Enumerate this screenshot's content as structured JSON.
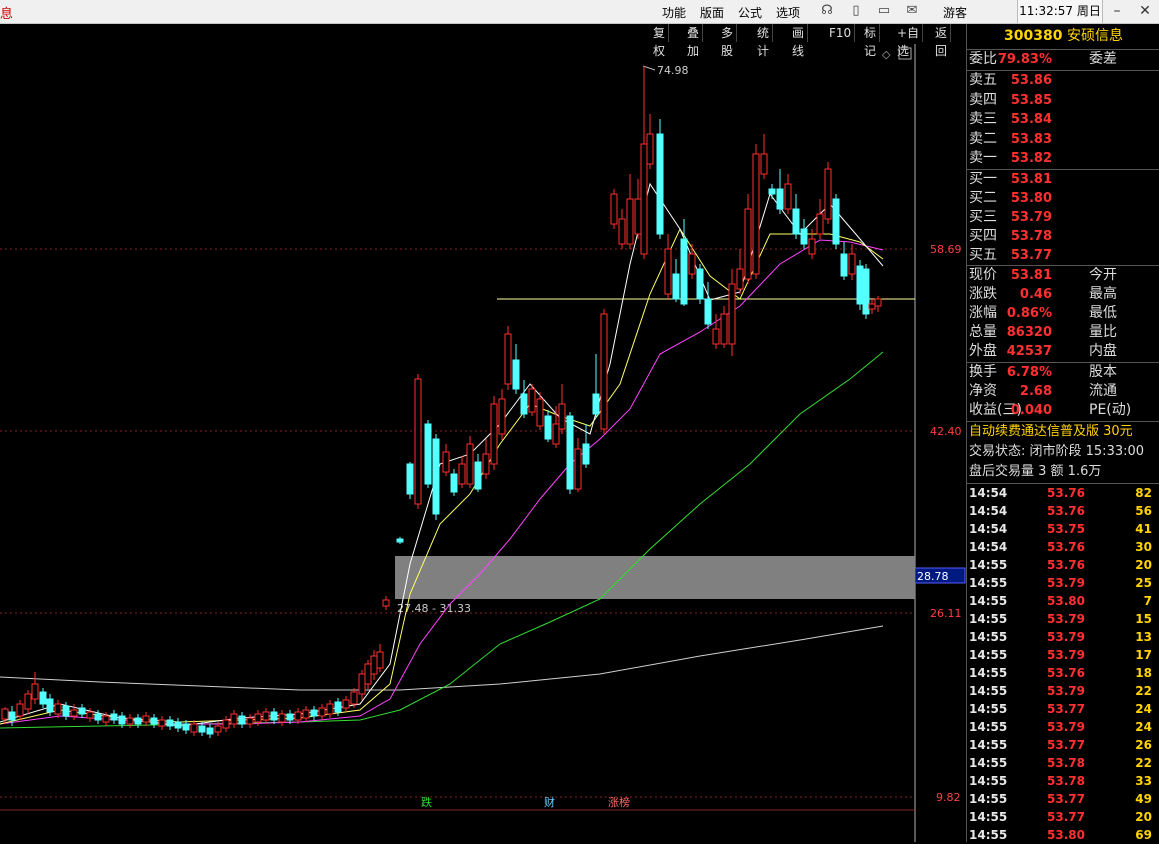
{
  "menubar": {
    "left_title": "息",
    "items": [
      "功能",
      "版面",
      "公式",
      "选项"
    ],
    "user": "游客",
    "clock": "11:32:57 周日"
  },
  "toolbar": [
    "复权",
    "叠加",
    "多股",
    "统计",
    "画线",
    "F10",
    "标记",
    "+自选",
    "返回"
  ],
  "chart": {
    "price_labels": [
      "58.69",
      "42.40",
      "26.11",
      "9.82"
    ],
    "current_box": "28.78",
    "high_label": "74.98",
    "zone_label": "27.48 - 31.33",
    "markers": [
      "跌",
      "财",
      "涨榜"
    ]
  },
  "chart_data": {
    "type": "candlestick",
    "y_axis_labels": [
      58.69,
      42.4,
      26.11,
      9.82
    ],
    "high": 74.98,
    "last": 53.81,
    "zone": [
      27.48,
      31.33
    ]
  },
  "panel": {
    "code": "300380",
    "name": "安硕信息",
    "weibi": {
      "label": "委比",
      "value": "79.83%",
      "label2": "委差"
    },
    "sell": [
      {
        "label": "卖五",
        "price": "53.86"
      },
      {
        "label": "卖四",
        "price": "53.85"
      },
      {
        "label": "卖三",
        "price": "53.84"
      },
      {
        "label": "卖二",
        "price": "53.83"
      },
      {
        "label": "卖一",
        "price": "53.82"
      }
    ],
    "buy": [
      {
        "label": "买一",
        "price": "53.81"
      },
      {
        "label": "买二",
        "price": "53.80"
      },
      {
        "label": "买三",
        "price": "53.79"
      },
      {
        "label": "买四",
        "price": "53.78"
      },
      {
        "label": "买五",
        "price": "53.77"
      }
    ],
    "quote": [
      {
        "label": "现价",
        "value": "53.81",
        "label2": "今开"
      },
      {
        "label": "涨跌",
        "value": "0.46",
        "label2": "最高"
      },
      {
        "label": "涨幅",
        "value": "0.86%",
        "label2": "最低"
      },
      {
        "label": "总量",
        "value": "86320",
        "label2": "量比"
      },
      {
        "label": "外盘",
        "value": "42537",
        "label2": "内盘"
      }
    ],
    "finance": [
      {
        "label": "换手",
        "value": "6.78%",
        "label2": "股本"
      },
      {
        "label": "净资",
        "value": "2.68",
        "label2": "流通"
      },
      {
        "label": "收益(三)",
        "value": "0.040",
        "label2": "PE(动)"
      }
    ],
    "ad_text": "自动续费通达信普及版 30元",
    "trade_status": "交易状态: 闭市阶段 15:33:00",
    "after_hours": "盘后交易量 3 额 1.6万",
    "ticks": [
      {
        "t": "14:54",
        "p": "53.76",
        "v": "82"
      },
      {
        "t": "14:54",
        "p": "53.76",
        "v": "56"
      },
      {
        "t": "14:54",
        "p": "53.75",
        "v": "41"
      },
      {
        "t": "14:54",
        "p": "53.76",
        "v": "30"
      },
      {
        "t": "14:55",
        "p": "53.76",
        "v": "20"
      },
      {
        "t": "14:55",
        "p": "53.79",
        "v": "25"
      },
      {
        "t": "14:55",
        "p": "53.80",
        "v": "7"
      },
      {
        "t": "14:55",
        "p": "53.79",
        "v": "15"
      },
      {
        "t": "14:55",
        "p": "53.79",
        "v": "13"
      },
      {
        "t": "14:55",
        "p": "53.79",
        "v": "17"
      },
      {
        "t": "14:55",
        "p": "53.76",
        "v": "18"
      },
      {
        "t": "14:55",
        "p": "53.79",
        "v": "22"
      },
      {
        "t": "14:55",
        "p": "53.77",
        "v": "24"
      },
      {
        "t": "14:55",
        "p": "53.79",
        "v": "24"
      },
      {
        "t": "14:55",
        "p": "53.77",
        "v": "26"
      },
      {
        "t": "14:55",
        "p": "53.78",
        "v": "22"
      },
      {
        "t": "14:55",
        "p": "53.78",
        "v": "33"
      },
      {
        "t": "14:55",
        "p": "53.77",
        "v": "49"
      },
      {
        "t": "14:55",
        "p": "53.77",
        "v": "20"
      },
      {
        "t": "14:55",
        "p": "53.80",
        "v": "69"
      }
    ]
  },
  "colors": {
    "up": "#ff3030",
    "down": "#54ffff",
    "ma5": "#ffffff",
    "ma10": "#ffff66",
    "ma20": "#ff44ff",
    "ma60": "#33dd33",
    "ma120": "#dddddd"
  }
}
